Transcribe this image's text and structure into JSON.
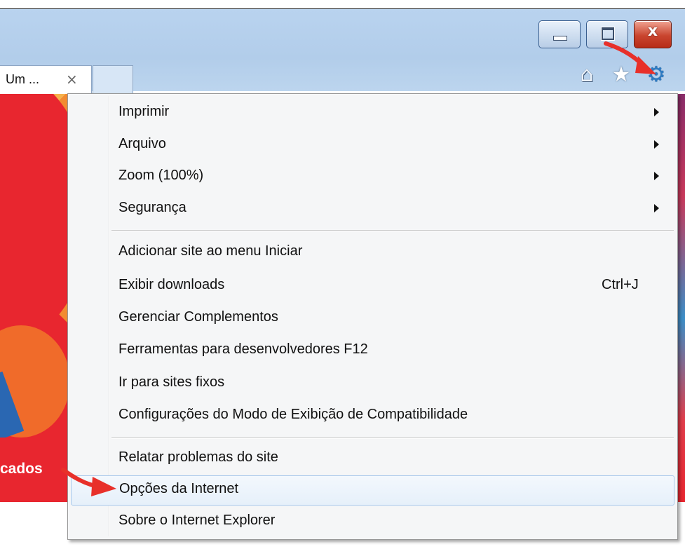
{
  "window": {
    "tab_title": "Um ...",
    "tab_close": "×",
    "close_glyph": "x",
    "buttons": [
      "minimize",
      "maximize",
      "close"
    ]
  },
  "toolbar": {
    "icons": [
      "home-icon",
      "favorites-star-icon",
      "tools-gear-icon"
    ]
  },
  "page": {
    "banner_text": "cados"
  },
  "menu": {
    "groups": [
      [
        {
          "label": "Imprimir",
          "submenu": true
        },
        {
          "label": "Arquivo",
          "submenu": true
        },
        {
          "label": "Zoom (100%)",
          "submenu": true
        },
        {
          "label": "Segurança",
          "submenu": true
        }
      ],
      [
        {
          "label": "Adicionar site ao menu Iniciar"
        },
        {
          "label": "Exibir downloads",
          "shortcut": "Ctrl+J"
        },
        {
          "label": "Gerenciar Complementos"
        },
        {
          "label": "Ferramentas para desenvolvedores F12"
        },
        {
          "label": "Ir para sites fixos"
        },
        {
          "label": "Configurações do Modo de Exibição de Compatibilidade"
        }
      ],
      [
        {
          "label": "Relatar problemas do site"
        },
        {
          "label": "Opções da Internet",
          "highlighted": true
        },
        {
          "label": "Sobre o Internet Explorer"
        }
      ]
    ]
  },
  "colors": {
    "annotation_arrow": "#e8302a",
    "highlight_border": "#a8c8eb",
    "gear": "#2d7bc3"
  }
}
